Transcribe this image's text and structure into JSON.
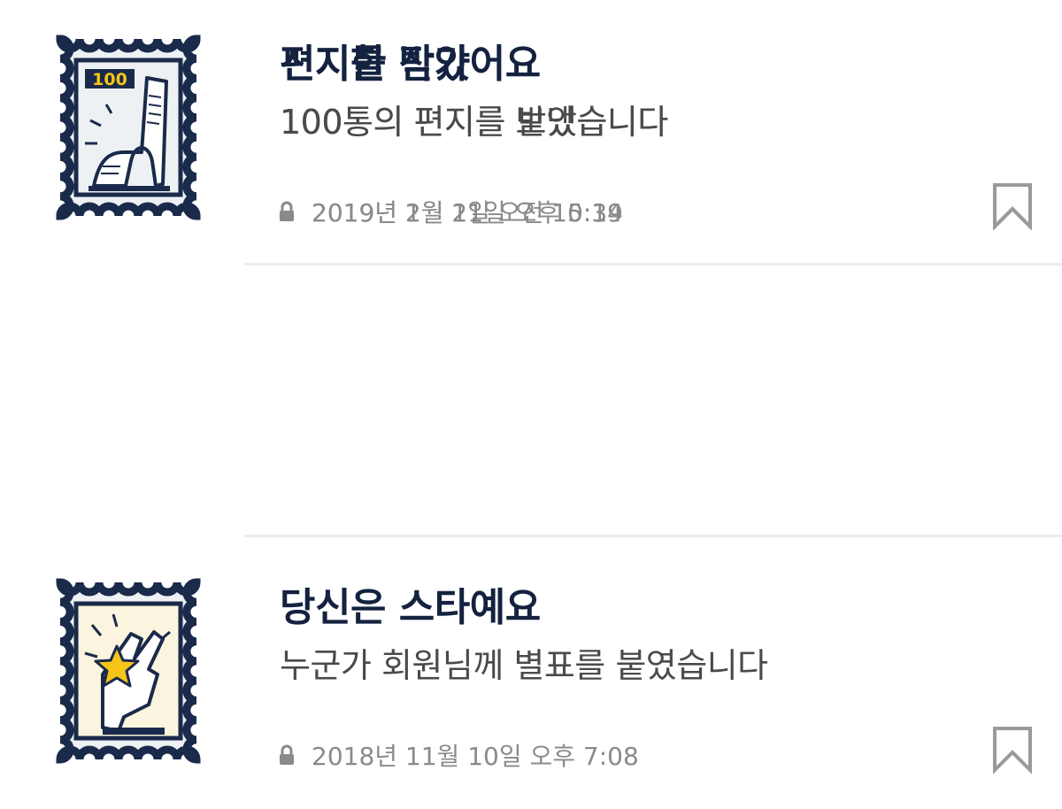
{
  "achievements": [
    {
      "title": "편지를 받았어요",
      "description": "100통의 편지를 받았습니다",
      "date": "2019년 2월 1일 오전 10:14",
      "badge_count": "100",
      "icon": "mailbox-stamp-icon"
    },
    {
      "title": "당신은 스타예요",
      "description": "누군가 회원님께 별표를 붙였습니다",
      "date": "2018년 11월 10일 오후 7:08",
      "icon": "star-hand-stamp-icon"
    },
    {
      "title": "진지한 작가",
      "description": "100통의 편지를 보냈습니다",
      "date": "2019년 1월 21일 오후 5:39",
      "badge_count": "100",
      "icon": "letter-scroll-stamp-icon"
    }
  ],
  "colors": {
    "title": "#142240",
    "stamp_border": "#1a2a4a",
    "stamp_fill": "#eef1f4",
    "accent_yellow": "#f5c518",
    "meta_gray": "#8a8a8a",
    "divider": "#ececec"
  }
}
